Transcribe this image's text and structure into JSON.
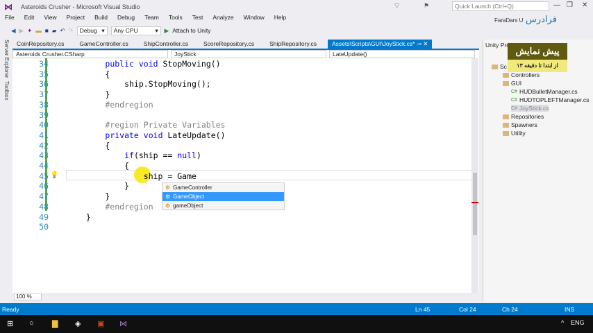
{
  "window": {
    "title": "Asteroids Crusher - Microsoft Visual Studio",
    "quick_launch_placeholder": "Quick Launch (Ctrl+Q)"
  },
  "menu": [
    "File",
    "Edit",
    "View",
    "Project",
    "Build",
    "Debug",
    "Team",
    "Tools",
    "Test",
    "Analyze",
    "Window",
    "Help"
  ],
  "toolbar": {
    "config": "Debug",
    "platform": "Any CPU",
    "attach": "Attach to Unity"
  },
  "side_tabs": [
    "Server Explorer",
    "Toolbox"
  ],
  "tabs": [
    "CoinRepository.cs",
    "GameController.cs",
    "ShipController.cs",
    "ScoreRepository.cs",
    "ShipRepository.cs",
    "Assets\\Scripts\\GUI\\JoyStick.cs*"
  ],
  "nav": {
    "project": "Asteroids Crusher.CSharp",
    "class": "JoyStick",
    "member": "LateUpdate()"
  },
  "code": [
    {
      "n": "34",
      "t": "        public void StopMoving()"
    },
    {
      "n": "35",
      "t": "        {"
    },
    {
      "n": "36",
      "t": "            ship.StopMoving();"
    },
    {
      "n": "37",
      "t": "        }"
    },
    {
      "n": "38",
      "t": "        #endregion"
    },
    {
      "n": "39",
      "t": ""
    },
    {
      "n": "40",
      "t": "        #region Private Variables"
    },
    {
      "n": "41",
      "t": "        private void LateUpdate()"
    },
    {
      "n": "42",
      "t": "        {"
    },
    {
      "n": "43",
      "t": "            if(ship == null)"
    },
    {
      "n": "44",
      "t": "            {"
    },
    {
      "n": "45",
      "t": "                ship = Game"
    },
    {
      "n": "46",
      "t": "            }"
    },
    {
      "n": "47",
      "t": "        }"
    },
    {
      "n": "48",
      "t": "        #endregion"
    },
    {
      "n": "49",
      "t": "    }"
    },
    {
      "n": "50",
      "t": ""
    }
  ],
  "completion": [
    "GameController",
    "GameObject",
    "gameObject"
  ],
  "zoom": "100 %",
  "right_panel": {
    "title": "Unity Pro",
    "root": "Sc",
    "items": [
      "Controllers",
      "GUI",
      "HUDBulletManager.cs",
      "HUDTOPLEFTManager.cs",
      "JoyStick.cs",
      "Repositories",
      "Spawners",
      "Utility"
    ]
  },
  "promo": {
    "line1": "پیش نمایش",
    "line2": "از ابتدا تا دقیقه ۱۳",
    "brand": "فرادرس",
    "brand_en": "FaraDars U"
  },
  "status": {
    "ready": "Ready",
    "ln": "Ln 45",
    "col": "Col 24",
    "ch": "Ch 24",
    "ins": "INS"
  },
  "taskbar": {
    "lang": "ENG"
  }
}
